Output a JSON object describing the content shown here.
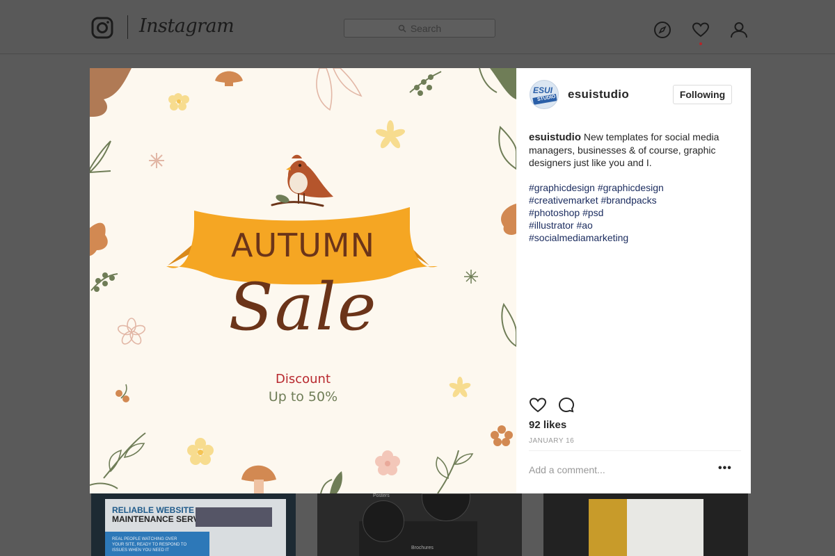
{
  "topbar": {
    "wordmark": "Instagram",
    "search_placeholder": "Search",
    "icons": [
      "instagram-logo-icon",
      "compass-icon",
      "heart-icon",
      "user-icon"
    ]
  },
  "post": {
    "image": {
      "ribbon_text": "AUTUMN",
      "sale_text": "Sale",
      "discount_text": "Discount",
      "upto_text": "Up to 50%"
    },
    "author": "esuistudio",
    "avatar_text": "ESUI",
    "avatar_sub": "STUDIO",
    "follow_label": "Following",
    "caption_user": "esuistudio",
    "caption_text": "New templates for social media managers, businesses & of course, graphic designers just like you and I.",
    "hashtags": [
      "#graphicdesign #graphicdesign",
      "#creativemarket #brandpacks",
      "#photoshop #psd",
      "#illustrator #ao",
      "#socialmediamarketing"
    ],
    "likes": "92 likes",
    "date": "JANUARY 16",
    "comment_placeholder": "Add a comment...",
    "more_label": "•••"
  },
  "feed_thumbs": {
    "thumb1_title_line1": "RELIABLE WEBSITE",
    "thumb1_title_line2": "MAINTENANCE SERVICES",
    "thumb1_text": "REAL PEOPLE WATCHING OVER YOUR SITE, READY TO RESPOND TO ISSUES WHEN YOU NEED IT",
    "thumb2_label1": "Posters",
    "thumb2_label2": "Brochures"
  },
  "colors": {
    "ribbon": "#f5a623",
    "brown_text": "#6b3419",
    "discount_red": "#b8282e",
    "olive": "#6f7d57",
    "link_blue": "#1a2b5e",
    "notification_dot": "#b3262a"
  }
}
